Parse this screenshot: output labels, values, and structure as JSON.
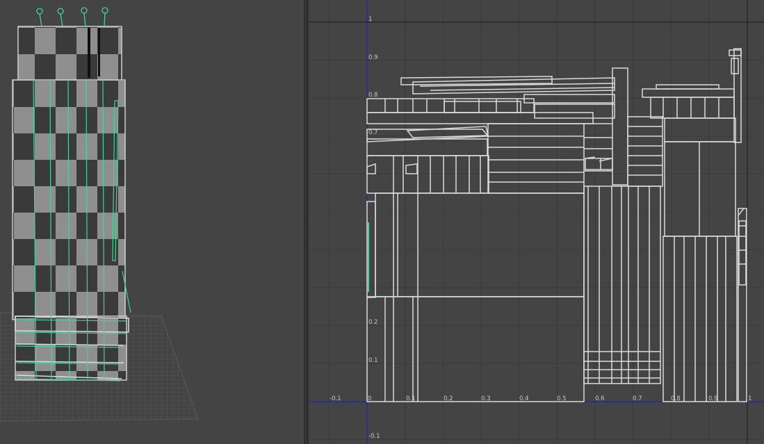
{
  "app": {
    "panels": [
      "perspective-viewport",
      "uv-texture-editor"
    ]
  },
  "colors": {
    "background": "#444444",
    "grid_line": "#3b3b3b",
    "uv_wire": "#dcdcdc",
    "axis_blue": "#2323b4",
    "selection_green": "#3ed69a",
    "checker_dark": "#3a3a3a",
    "checker_light": "#8f8f8f"
  },
  "uv_editor": {
    "tick_labels_x": [
      "-0.1",
      "0",
      "0.1",
      "0.2",
      "0.3",
      "0.4",
      "0.5",
      "0.6",
      "0.7",
      "0.8",
      "0.9",
      "1"
    ],
    "tick_labels_y": [
      "1",
      "0.9",
      "0.8",
      "0.7",
      "0.2",
      "0.1",
      "-0.1"
    ]
  }
}
